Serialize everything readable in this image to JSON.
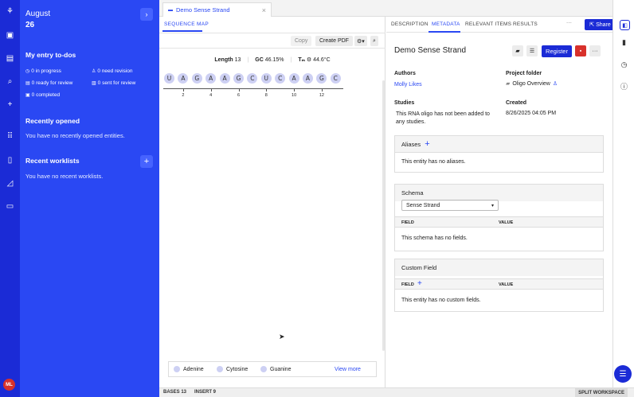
{
  "sidebar": {
    "month": "August",
    "day": "26",
    "todos_title": "My entry to-dos",
    "todos": [
      {
        "icon": "clock-icon",
        "label": "0 in progress"
      },
      {
        "icon": "person-icon",
        "label": "0 need revision"
      },
      {
        "icon": "clipboard-icon",
        "label": "0 ready for review"
      },
      {
        "icon": "document-icon",
        "label": "0 sent for review"
      },
      {
        "icon": "check-icon",
        "label": "0 completed"
      }
    ],
    "recent_title": "Recently opened",
    "recent_empty": "You have no recently opened entities.",
    "worklists_title": "Recent worklists",
    "worklists_empty": "You have no recent worklists.",
    "avatar_initials": "ML"
  },
  "tab": {
    "title": "Demo Sense Strand"
  },
  "sequence": {
    "tab_label": "SEQUENCE MAP",
    "copy_label": "Copy",
    "pdf_label": "Create PDF",
    "length_label": "Length",
    "length_value": "13",
    "gc_label": "GC",
    "gc_value": "46.15%",
    "tm_label": "Tₘ",
    "tm_value": "44.6°C",
    "bases": [
      "U",
      "A",
      "G",
      "A",
      "A",
      "G",
      "C",
      "U",
      "C",
      "A",
      "A",
      "G",
      "C"
    ],
    "ticks": [
      "2",
      "4",
      "6",
      "8",
      "10",
      "12"
    ],
    "legend": [
      "Adenine",
      "Cytosine",
      "Guanine"
    ],
    "view_more": "View more"
  },
  "status": {
    "bases": "BASES 13",
    "insert": "INSERT 9",
    "split": "SPLIT WORKSPACE"
  },
  "meta": {
    "tabs": [
      "DESCRIPTION",
      "METADATA",
      "RELEVANT ITEMS",
      "RESULTS"
    ],
    "share_label": "Share",
    "title": "Demo Sense Strand",
    "register_label": "Register",
    "authors_label": "Authors",
    "author": "Molly Likes",
    "folder_label": "Project folder",
    "folder": "Oligo Overview",
    "studies_label": "Studies",
    "studies_text": "This RNA oligo has not been added to any studies.",
    "created_label": "Created",
    "created_value": "8/26/2025 04:05 PM",
    "aliases_title": "Aliases",
    "aliases_empty": "This entity has no aliases.",
    "schema_title": "Schema",
    "schema_value": "Sense Strand",
    "field_label": "FIELD",
    "value_label": "VALUE",
    "schema_empty": "This schema has no fields.",
    "custom_title": "Custom Field",
    "custom_empty": "This entity has no custom fields."
  },
  "colors": {
    "accent": "#2a48f3",
    "rail": "#1b2bd6",
    "base_fill": "#cdd0f3"
  }
}
